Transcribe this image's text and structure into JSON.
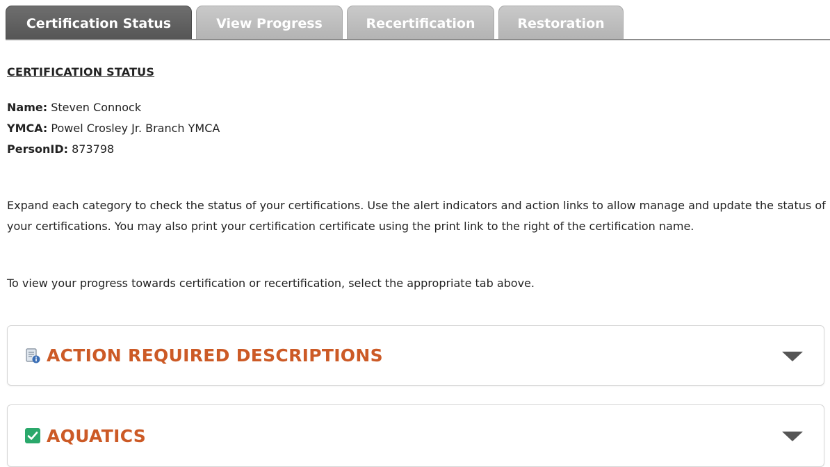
{
  "tabs": [
    {
      "label": "Certification Status",
      "active": true
    },
    {
      "label": "View Progress",
      "active": false
    },
    {
      "label": "Recertification",
      "active": false
    },
    {
      "label": "Restoration",
      "active": false
    }
  ],
  "section_title": "CERTIFICATION STATUS",
  "profile": {
    "name_label": "Name:",
    "name_value": "Steven Connock",
    "ymca_label": "YMCA:",
    "ymca_value": "Powel Crosley Jr. Branch YMCA",
    "person_label": "PersonID:",
    "person_value": "873798"
  },
  "paragraphs": [
    "Expand each category to check the status of your certifications. Use the alert indicators and action links to allow manage and update the status of your certifications. You may also print your certification certificate using the print link to the right of the certification name.",
    "To view your progress towards certification or recertification, select the appropriate tab above."
  ],
  "panels": [
    {
      "title": "ACTION REQUIRED DESCRIPTIONS",
      "icon": "document-info-icon"
    },
    {
      "title": "AQUATICS",
      "icon": "checkbox-checked-icon"
    }
  ],
  "colors": {
    "accent": "#cc5a26",
    "tab_active": "#5f5f5f",
    "tab_inactive": "#bdbdbd",
    "check_green": "#2aa86b"
  }
}
